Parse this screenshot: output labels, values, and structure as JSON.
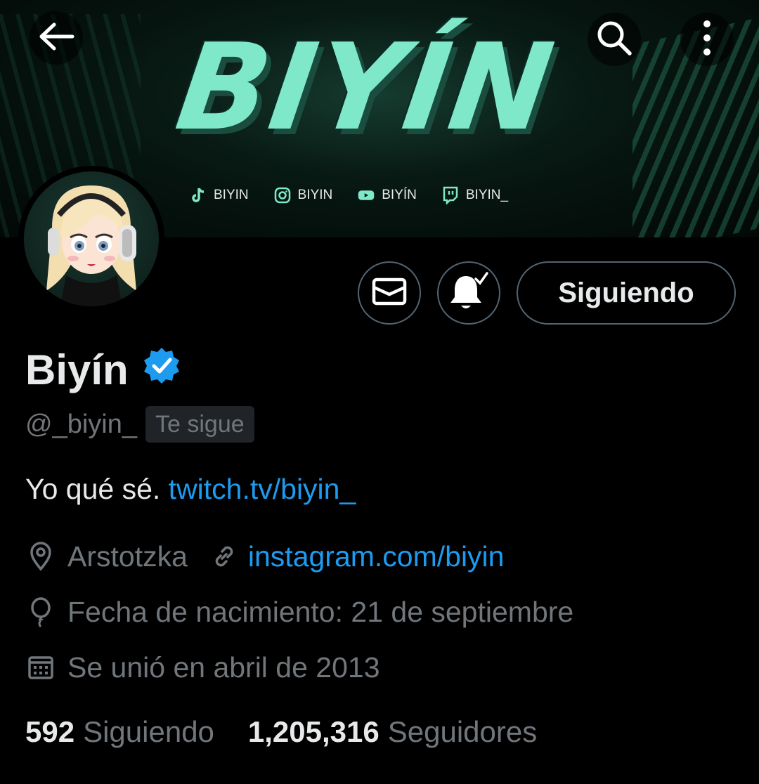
{
  "banner": {
    "title": "BIYÍN",
    "socials": [
      {
        "icon": "tiktok-icon",
        "label": "BIYIN"
      },
      {
        "icon": "instagram-icon",
        "label": "BIYIN"
      },
      {
        "icon": "youtube-icon",
        "label": "BIYÍN"
      },
      {
        "icon": "twitch-icon",
        "label": "BIYIN_"
      }
    ]
  },
  "nav": {
    "back_icon": "arrow-left-icon",
    "search_icon": "search-icon",
    "more_icon": "more-vertical-icon"
  },
  "actions": {
    "message_icon": "envelope-icon",
    "notifications_icon": "bell-check-icon",
    "follow_label": "Siguiendo"
  },
  "profile": {
    "display_name": "Biyín",
    "verified": true,
    "handle": "@_biyin_",
    "follows_you": "Te sigue",
    "bio_text": "Yo qué sé. ",
    "bio_link": "twitch.tv/biyin_",
    "location": "Arstotzka",
    "website": "instagram.com/biyin",
    "birthday": "Fecha de nacimiento: 21 de septiembre",
    "joined": "Se unió en abril de 2013"
  },
  "stats": {
    "following_count": "592",
    "following_label": "Siguiendo",
    "followers_count": "1,205,316",
    "followers_label": "Seguidores"
  },
  "colors": {
    "accent": "#1d9bf0",
    "banner_text": "#7ee8c8",
    "muted": "#71767b",
    "border": "#536471"
  }
}
